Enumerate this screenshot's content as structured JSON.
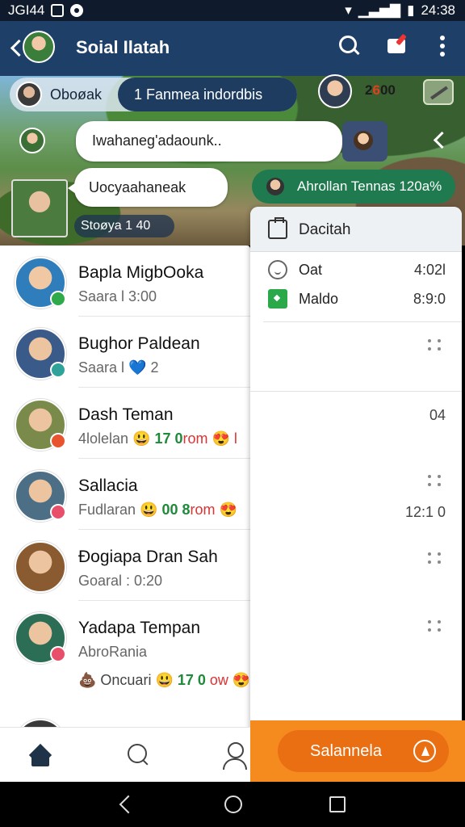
{
  "statusbar": {
    "time_left": "JGI44",
    "time_right": "24:38"
  },
  "appbar": {
    "title": "Soial Ilatah"
  },
  "scene": {
    "group_name": "Oboøak",
    "group_pill": "1  Fanmea indordbis",
    "score": "2",
    "score_fire": "6",
    "score_tail": "00",
    "bubble1": "Iwahaneg'adaounk..",
    "bubble2": "Uocyaahaneak",
    "time_pill": "Stoøya 1 40",
    "green_pill": "Ahrollan Tennas 120a%"
  },
  "chats": [
    {
      "name": "Bapla MigbOoka",
      "sub": "Saara l  3:00",
      "avatar_color": "#2f7dbb",
      "badge_color": "#2faa4a"
    },
    {
      "name": "Bughor Paldean",
      "sub": "Saara l  💙 2",
      "avatar_color": "#3a5a8a",
      "badge_color": "#2fa39a"
    },
    {
      "name": "Dash Teman",
      "sub_pre": "4lolelan 😃 ",
      "sub_g": "17 0",
      "sub_post": "rom 😍 l",
      "avatar_color": "#7a8a4a",
      "badge_color": "#e8542d"
    },
    {
      "name": "Sallacia",
      "sub_pre": "Fudlaran 😃 ",
      "sub_g": "00 8",
      "sub_post": "rom 😍",
      "avatar_color": "#4d6f86",
      "badge_color": "#e84f6a"
    },
    {
      "name": "Đogiapa Dran Sah",
      "sub": "Goaral : 0:20",
      "avatar_color": "#8a5a30",
      "badge_color": ""
    },
    {
      "name": "Yadapa Tempan",
      "sub": "AbroRania",
      "sub2_pre": "💩 Oncuari 😃 ",
      "sub2_g": "17 0",
      "sub2_post": " ow 😍 l",
      "avatar_color": "#2b6e55",
      "badge_color": "#e84f6a"
    }
  ],
  "panel": {
    "title": "Dacitah",
    "rows": [
      {
        "label": "Oat",
        "value": "4:02l"
      },
      {
        "label": "Maldo",
        "value": "8:9:0"
      }
    ],
    "values": [
      "04",
      "12:1 0"
    ]
  },
  "cta": {
    "label": "Salannela"
  }
}
